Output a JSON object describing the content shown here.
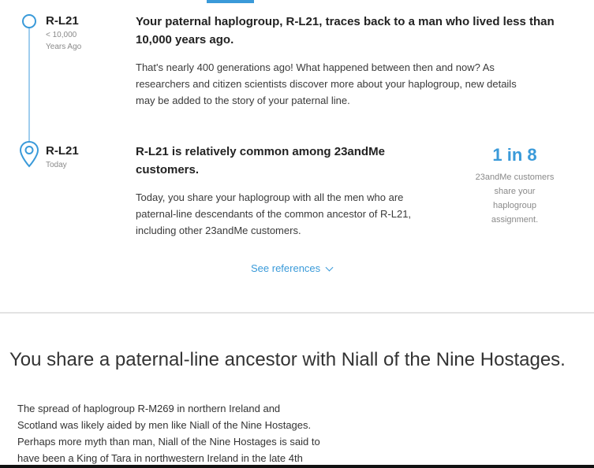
{
  "timeline": {
    "stages": [
      {
        "name": "R-L21",
        "sub1": "< 10,000",
        "sub2": "Years Ago",
        "heading_line1": "Your paternal haplogroup, R-L21, traces back to a man who lived less than",
        "heading_line2": "10,000 years ago.",
        "para_lines": [
          "That's nearly 400 generations ago! What happened between then and now? As",
          "researchers and citizen scientists discover more about your haplogroup, new details",
          "may be added to the story of your paternal line."
        ]
      },
      {
        "name": "R-L21",
        "sub1": "Today",
        "heading_line1": "R-L21 is relatively common among 23andMe",
        "heading_line2": "customers.",
        "para_lines": [
          "Today, you share your haplogroup with all the men who are",
          "paternal-line descendants of the common ancestor of R-L21,",
          "including other 23andMe customers."
        ]
      }
    ],
    "stat": {
      "value": "1 in 8",
      "desc_lines": [
        "23andMe customers",
        "share your",
        "haplogroup",
        "assignment."
      ]
    },
    "references_label": "See references"
  },
  "ancestor_section": {
    "title": "You share a paternal-line ancestor with Niall of the Nine Hostages.",
    "para_lines": [
      "The spread of haplogroup R-M269 in northern Ireland and",
      "Scotland was likely aided by men like Niall of the Nine Hostages.",
      "Perhaps more myth than man, Niall of the Nine Hostages is said to",
      "have been a King of Tara in northwestern Ireland in the late 4th"
    ]
  },
  "colors": {
    "accent": "#3a9ad9",
    "timeline_line": "#9fcdee",
    "muted": "#8a8a8a"
  },
  "icons": {
    "stage1": "circle-node-icon",
    "stage2": "location-pin-icon",
    "references": "chevron-down-icon"
  }
}
